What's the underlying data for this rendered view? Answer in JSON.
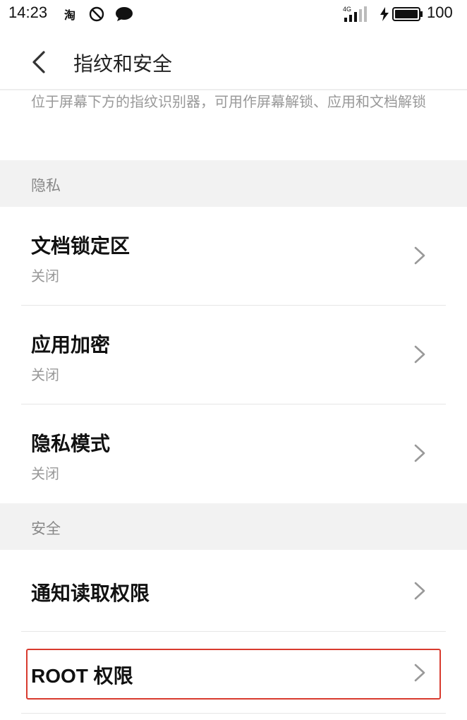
{
  "status_bar": {
    "time": "14:23",
    "taobao_icon_text": "淘",
    "network_type": "4G",
    "battery_level": "100",
    "icons": [
      "taobao-icon",
      "do-not-disturb-icon",
      "message-icon",
      "signal-icon",
      "charging-icon",
      "battery-icon"
    ]
  },
  "header": {
    "title": "指纹和安全"
  },
  "fingerprint": {
    "description": "位于屏幕下方的指纹识别器，可用作屏幕解锁、应用和文档解锁"
  },
  "privacy_section": {
    "label": "隐私",
    "items": [
      {
        "title": "文档锁定区",
        "status": "关闭"
      },
      {
        "title": "应用加密",
        "status": "关闭"
      },
      {
        "title": "隐私模式",
        "status": "关闭"
      }
    ]
  },
  "security_section": {
    "label": "安全",
    "items": [
      {
        "title": "通知读取权限"
      },
      {
        "title": "ROOT 权限"
      }
    ]
  },
  "colors": {
    "highlight_border": "#d83a2e",
    "section_background": "#f2f2f2",
    "secondary_text": "#999999"
  }
}
